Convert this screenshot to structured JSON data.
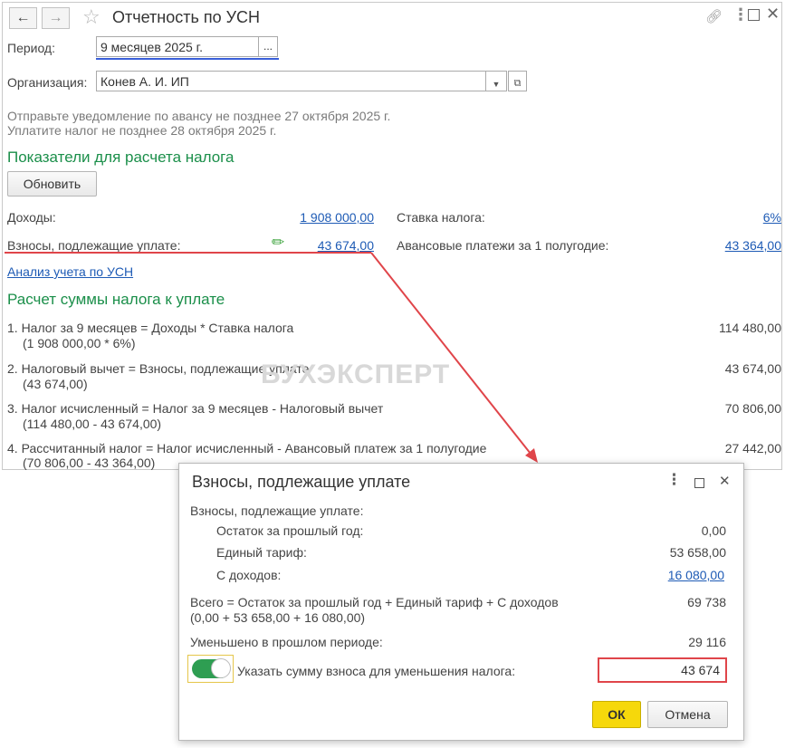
{
  "window": {
    "title": "Отчетность по УСН",
    "nav_back": "🡐",
    "nav_forward": "🡒",
    "period_label": "Период:",
    "period_value": "9 месяцев 2025 г.",
    "period_btn": "...",
    "org_label": "Организация:",
    "org_value": "Конев А. И. ИП",
    "notice1": "Отправьте уведомление по авансу не позднее 27 октября 2025 г.",
    "notice2": "Уплатите налог не позднее 28 октября 2025 г.",
    "section1": "Показатели для расчета налога",
    "refresh_btn": "Обновить",
    "income_label": "Доходы:",
    "income_value": "1 908 000,00",
    "contrib_label": "Взносы, подлежащие уплате:",
    "contrib_value": "43 674,00",
    "rate_label": "Ставка налога:",
    "rate_value": "6%",
    "advance_label": "Авансовые платежи за 1 полугодие:",
    "advance_value": "43 364,00",
    "analysis_link": "Анализ учета по УСН",
    "section2": "Расчет суммы налога к уплате",
    "calc": [
      {
        "line1": "1. Налог за 9 месяцев = Доходы * Ставка налога",
        "line2": "(1 908 000,00 * 6%)",
        "value": "114 480,00"
      },
      {
        "line1": "2. Налоговый вычет = Взносы, подлежащие уплате",
        "line2": "(43 674,00)",
        "value": "43 674,00"
      },
      {
        "line1": "3. Налог исчисленный = Налог за 9 месяцев - Налоговый вычет",
        "line2": "(114 480,00 - 43 674,00)",
        "value": "70 806,00"
      },
      {
        "line1": "4. Рассчитанный налог = Налог исчисленный - Авансовый платеж за 1 полугодие",
        "line2": "(70 806,00 - 43 364,00)",
        "value": "27 442,00"
      }
    ],
    "watermark": "БУХЭКСПЕРТ"
  },
  "dialog": {
    "title": "Взносы, подлежащие уплате",
    "header": "Взносы, подлежащие уплате:",
    "rows": [
      {
        "label": "Остаток за прошлый год:",
        "value": "0,00"
      },
      {
        "label": "Единый тариф:",
        "value": "53 658,00"
      },
      {
        "label": "С доходов:",
        "value": "16 080,00"
      }
    ],
    "total_line1": "Всего = Остаток за прошлый год + Единый тариф + С доходов",
    "total_line2": "(0,00 + 53 658,00 + 16 080,00)",
    "total_value": "69 738",
    "reduced_label": "Уменьшено в прошлом периоде:",
    "reduced_value": "29 116",
    "toggle_label": "Указать сумму взноса для уменьшения налога:",
    "toggle_on": true,
    "input_value": "43 674",
    "ok_btn": "ОК",
    "cancel_btn": "Отмена"
  },
  "colors": {
    "accent_green": "#1b8f4a",
    "link_blue": "#1e5bb5",
    "highlight_red": "#e0454a",
    "ok_yellow": "#f6d80b"
  }
}
